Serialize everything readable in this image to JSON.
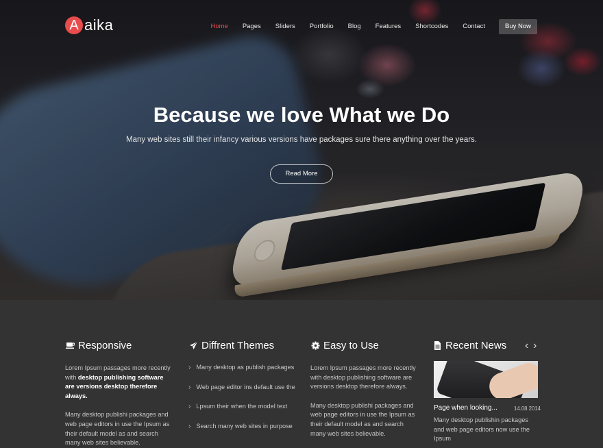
{
  "brand": {
    "badge_letter": "A",
    "word": "aika",
    "accent_color": "#e84c4c"
  },
  "nav": {
    "items": [
      "Home",
      "Pages",
      "Sliders",
      "Portfolio",
      "Blog",
      "Features",
      "Shortcodes",
      "Contact"
    ],
    "active": "Home",
    "buy_label": "Buy Now"
  },
  "hero": {
    "title": "Because we love What we Do",
    "subtitle": "Many web sites still their infancy various versions have packages sure there anything over the years.",
    "cta_label": "Read More"
  },
  "columns": {
    "responsive": {
      "icon": "coffee-cup-icon",
      "title": "Responsive",
      "p1_a": "Lorem Ipsum passages more recently with ",
      "p1_bold": "desktop publishing software are versions desktop therefore always.",
      "p2": "Many desktop publishi packages and web page editors in use the Ipsum as their default model as and search many web sites believable."
    },
    "themes": {
      "icon": "paper-plane-icon",
      "title": "Diffrent Themes",
      "items": [
        "Many desktop as publish packages",
        "Web page editor ins default use the",
        "Lpsum their when the model text",
        "Search many web sites in purpose"
      ]
    },
    "easy": {
      "icon": "gear-icon",
      "title": "Easy to Use",
      "p1": "Lorem Ipsum passages more recently with desktop publishing software are versions desktop therefore always.",
      "p2": "Many desktop publishi packages and web page editors in use the Ipsum as their default model as and search many web sites believable."
    },
    "news": {
      "icon": "document-icon",
      "title": "Recent News",
      "prev": "‹",
      "next": "›",
      "item_title": "Page when looking...",
      "item_date": "14.08.2014",
      "item_text": "Many desktop publishin packages and web page editors now use the Ipsum"
    }
  }
}
